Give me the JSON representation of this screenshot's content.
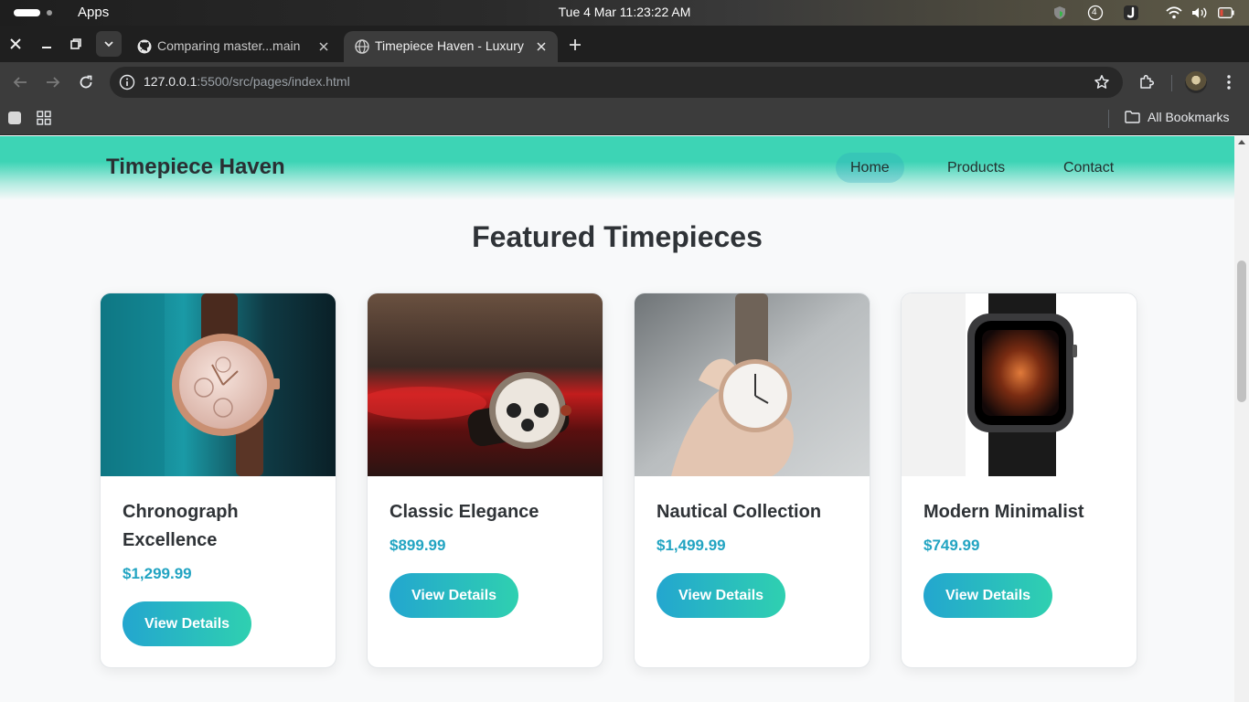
{
  "os": {
    "apps_label": "Apps",
    "clock": "Tue 4 Mar  11:23:22 AM",
    "tray_icons": [
      "shield-icon",
      "notification-count-icon",
      "app-j-icon",
      "wifi-icon",
      "volume-icon",
      "battery-icon"
    ],
    "notification_count": "4"
  },
  "browser": {
    "tabs": [
      {
        "title": "Comparing master...main",
        "favicon": "github-icon",
        "active": false
      },
      {
        "title": "Timepiece Haven - Luxury",
        "favicon": "globe-icon",
        "active": true
      }
    ],
    "url_host": "127.0.0.1",
    "url_path": ":5500/src/pages/index.html",
    "bookmarks_all_label": "All Bookmarks"
  },
  "site": {
    "logo": "Timepiece Haven",
    "nav": [
      {
        "label": "Home",
        "active": true
      },
      {
        "label": "Products",
        "active": false
      },
      {
        "label": "Contact",
        "active": false
      }
    ],
    "section_title": "Featured Timepieces",
    "products": [
      {
        "name": "Chronograph Excellence",
        "price": "$1,299.99",
        "button": "View Details"
      },
      {
        "name": "Classic Elegance",
        "price": "$899.99",
        "button": "View Details"
      },
      {
        "name": "Nautical Collection",
        "price": "$1,499.99",
        "button": "View Details"
      },
      {
        "name": "Modern Minimalist",
        "price": "$749.99",
        "button": "View Details"
      }
    ]
  },
  "colors": {
    "header_accent": "#3dd4b5",
    "price": "#22a4c2",
    "button_gradient_start": "#23a6cf",
    "button_gradient_end": "#2fd0b0"
  }
}
